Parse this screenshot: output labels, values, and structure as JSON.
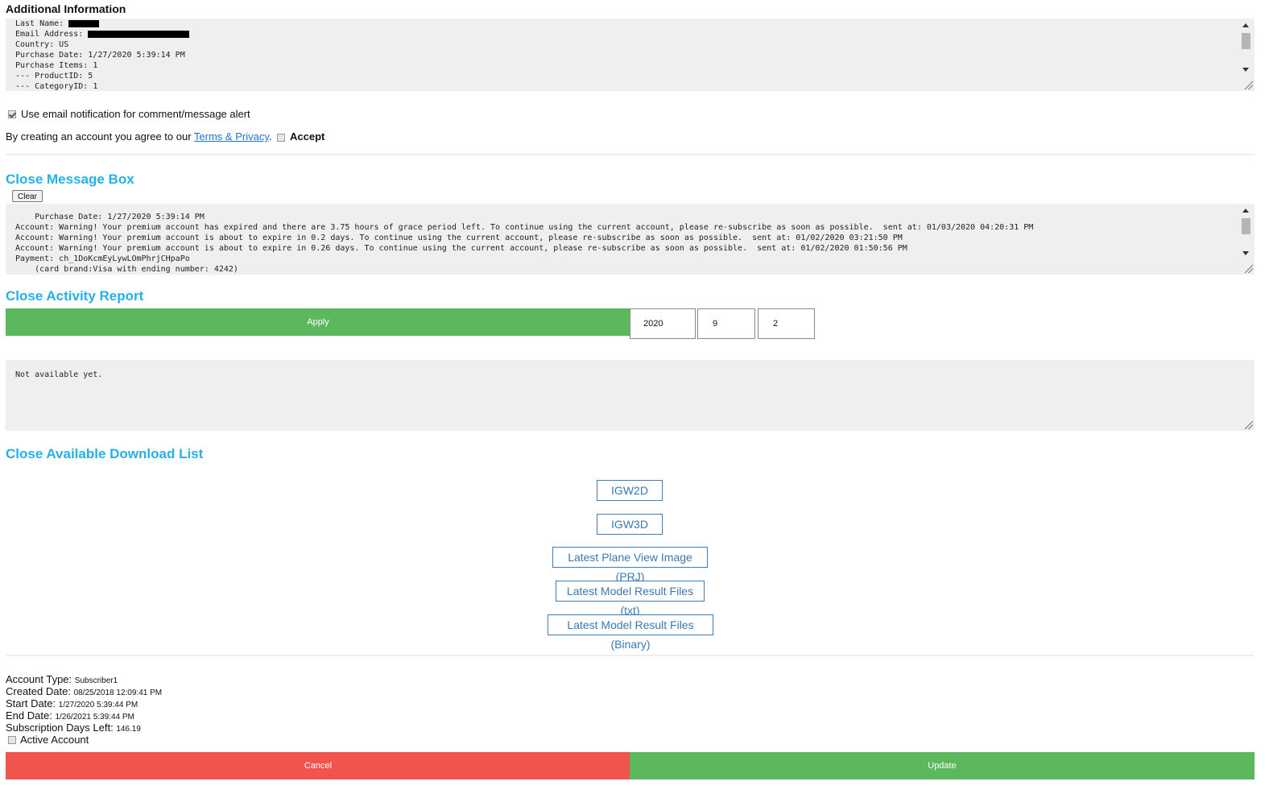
{
  "additional": {
    "title": "Additional Information",
    "lines": {
      "last_name_label": "Last Name: ",
      "email_label": "Email Address: ",
      "rest": "Country: US\nPurchase Date: 1/27/2020 5:39:14 PM\nPurchase Items: 1\n--- ProductID: 5\n--- CategoryID: 1"
    }
  },
  "email_notify": {
    "label": "Use email notification for comment/message alert",
    "checked": true
  },
  "terms": {
    "prefix": "By creating an account you agree to our ",
    "link": "Terms & Privacy",
    "suffix": ".",
    "accept_label": "Accept",
    "accepted": false
  },
  "message_box": {
    "title": "Close Message Box",
    "clear_label": "Clear",
    "content": "    Purchase Date: 1/27/2020 5:39:14 PM\nAccount: Warning! Your premium account has expired and there are 3.75 hours of grace period left. To continue using the current account, please re-subscribe as soon as possible.  sent at: 01/03/2020 04:20:31 PM\nAccount: Warning! Your premium account is about to expire in 0.2 days. To continue using the current account, please re-subscribe as soon as possible.  sent at: 01/02/2020 03:21:50 PM\nAccount: Warning! Your premium account is about to expire in 0.26 days. To continue using the current account, please re-subscribe as soon as possible.  sent at: 01/02/2020 01:50:56 PM\nPayment: ch_1DoKcmEyLywLOmPhrjCHpaPo\n    (card brand:Visa with ending number: 4242)"
  },
  "activity": {
    "title": "Close Activity Report",
    "apply_label": "Apply",
    "year": "2020",
    "month": "9",
    "day": "2",
    "report": "Not available yet."
  },
  "downloads": {
    "title": "Close Available Download List",
    "items": [
      "IGW2D",
      "IGW3D",
      "Latest Plane View Image (PRJ)",
      "Latest Model Result Files (txt)",
      "Latest Model Result Files (Binary)"
    ]
  },
  "account": {
    "type_label": "Account Type:",
    "type_value": "Subscriber1",
    "created_label": "Created Date:",
    "created_value": "08/25/2018 12:09:41 PM",
    "start_label": "Start Date:",
    "start_value": "1/27/2020 5:39:44 PM",
    "end_label": "End Date:",
    "end_value": "1/26/2021 5:39:44 PM",
    "days_label": "Subscription Days Left:",
    "days_value": "146.19",
    "active_label": "Active Account",
    "active": false
  },
  "footer": {
    "cancel_label": "Cancel",
    "update_label": "Update"
  },
  "colors": {
    "accent_blue": "#26b0e6",
    "green": "#5cb85c",
    "red": "#f0544c",
    "link": "#1f73c9"
  }
}
